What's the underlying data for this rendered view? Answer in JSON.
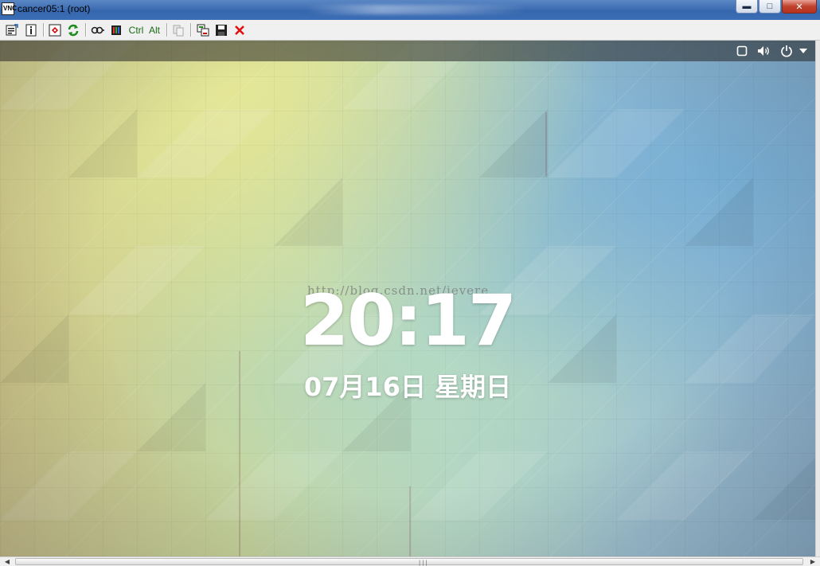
{
  "window": {
    "icon_label": "VNC",
    "title": "cancer05:1 (root)",
    "controls": {
      "minimize": "▬",
      "maximize": "□",
      "close": "✕"
    }
  },
  "toolbar": {
    "ctrl_label": "Ctrl",
    "alt_label": "Alt",
    "icons": [
      "options-icon",
      "info-icon",
      "fullscreen-icon",
      "refresh-icon",
      "key-icon",
      "ctrl-alt-del-icon",
      "copy-icon",
      "transfer-icon",
      "save-icon",
      "disconnect-icon"
    ]
  },
  "lockscreen": {
    "time": "20:17",
    "date": "07月16日 星期日",
    "watermark": "http://blog.csdn.net/ievere"
  },
  "system_tray": {
    "icons": [
      "window-icon",
      "volume-icon",
      "power-icon",
      "dropdown-arrow-icon"
    ]
  },
  "colors": {
    "titlebar": "#3f6fb3",
    "close_button": "#c0412c",
    "toolbar_text_green": "#1a6a14"
  }
}
